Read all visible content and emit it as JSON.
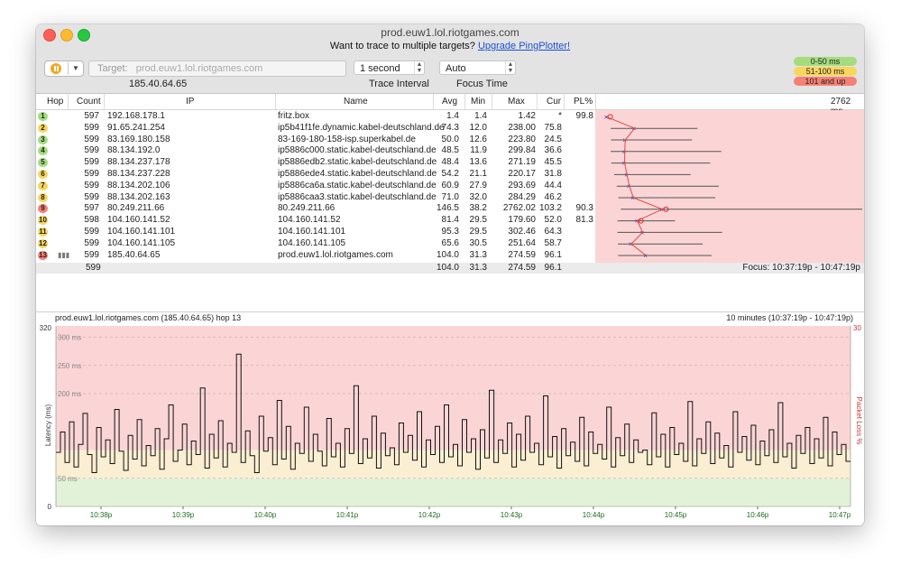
{
  "window": {
    "title": "prod.euw1.lol.riotgames.com"
  },
  "promo": {
    "text": "Want to trace to multiple targets?",
    "link": "Upgrade PingPlotter!"
  },
  "toolbar": {
    "target_label": "Target:",
    "target_value": "prod.euw1.lol.riotgames.com",
    "resolved_ip": "185.40.64.65",
    "interval_value": "1 second",
    "interval_label": "Trace Interval",
    "focus_value": "Auto",
    "focus_label": "Focus Time"
  },
  "latency_legend": [
    {
      "label": "0-50 ms",
      "color": "#a4dc7e"
    },
    {
      "label": "51-100 ms",
      "color": "#f7d65c"
    },
    {
      "label": "101 and up",
      "color": "#f77f74"
    }
  ],
  "table": {
    "columns": [
      "Hop",
      "Count",
      "IP",
      "Name",
      "Avg",
      "Min",
      "Max",
      "Cur",
      "PL%"
    ],
    "graph_max": "2762 ms",
    "rows": [
      {
        "hop": "1",
        "color": "#a4dc7e",
        "count": "597",
        "ip": "192.168.178.1",
        "name": "fritz.box",
        "avg": "1.4",
        "min": "1.4",
        "max": "1.42",
        "cur": "*",
        "pl": "99.8"
      },
      {
        "hop": "2",
        "color": "#f7d65c",
        "count": "599",
        "ip": "91.65.241.254",
        "name": "ip5b41f1fe.dynamic.kabel-deutschland.de",
        "avg": "74.3",
        "min": "12.0",
        "max": "238.00",
        "cur": "75.8",
        "pl": ""
      },
      {
        "hop": "3",
        "color": "#a4dc7e",
        "count": "599",
        "ip": "83.169.180.158",
        "name": "83-169-180-158-isp.superkabel.de",
        "avg": "50.0",
        "min": "12.6",
        "max": "223.80",
        "cur": "24.5",
        "pl": ""
      },
      {
        "hop": "4",
        "color": "#a4dc7e",
        "count": "599",
        "ip": "88.134.192.0",
        "name": "ip5886c000.static.kabel-deutschland.de",
        "avg": "48.5",
        "min": "11.9",
        "max": "299.84",
        "cur": "36.6",
        "pl": ""
      },
      {
        "hop": "5",
        "color": "#a4dc7e",
        "count": "599",
        "ip": "88.134.237.178",
        "name": "ip5886edb2.static.kabel-deutschland.de",
        "avg": "48.4",
        "min": "13.6",
        "max": "271.19",
        "cur": "45.5",
        "pl": ""
      },
      {
        "hop": "6",
        "color": "#f7d65c",
        "count": "599",
        "ip": "88.134.237.228",
        "name": "ip5886ede4.static.kabel-deutschland.de",
        "avg": "54.2",
        "min": "21.1",
        "max": "220.17",
        "cur": "31.8",
        "pl": ""
      },
      {
        "hop": "7",
        "color": "#f7d65c",
        "count": "599",
        "ip": "88.134.202.106",
        "name": "ip5886ca6a.static.kabel-deutschland.de",
        "avg": "60.9",
        "min": "27.9",
        "max": "293.69",
        "cur": "44.4",
        "pl": ""
      },
      {
        "hop": "8",
        "color": "#f7d65c",
        "count": "599",
        "ip": "88.134.202.163",
        "name": "ip5886caa3.static.kabel-deutschland.de",
        "avg": "71.0",
        "min": "32.0",
        "max": "284.29",
        "cur": "46.2",
        "pl": ""
      },
      {
        "hop": "9",
        "color": "#f77f74",
        "count": "597",
        "ip": "80.249.211.66",
        "name": "80.249.211.66",
        "avg": "146.5",
        "min": "38.2",
        "max": "2762.02",
        "cur": "103.2",
        "pl": "90.3"
      },
      {
        "hop": "10",
        "color": "#f7d65c",
        "count": "598",
        "ip": "104.160.141.52",
        "name": "104.160.141.52",
        "avg": "81.4",
        "min": "29.5",
        "max": "179.60",
        "cur": "52.0",
        "pl": "81.3"
      },
      {
        "hop": "11",
        "color": "#f7d65c",
        "count": "599",
        "ip": "104.160.141.101",
        "name": "104.160.141.101",
        "avg": "95.3",
        "min": "29.5",
        "max": "302.46",
        "cur": "64.3",
        "pl": ""
      },
      {
        "hop": "12",
        "color": "#f7d65c",
        "count": "599",
        "ip": "104.160.141.105",
        "name": "104.160.141.105",
        "avg": "65.6",
        "min": "30.5",
        "max": "251.64",
        "cur": "58.7",
        "pl": ""
      },
      {
        "hop": "13",
        "color": "#f77f74",
        "count": "599",
        "ip": "185.40.64.65",
        "name": "prod.euw1.lol.riotgames.com",
        "avg": "104.0",
        "min": "31.3",
        "max": "274.59",
        "cur": "96.1",
        "pl": ""
      }
    ],
    "summary": {
      "count": "599",
      "avg": "104.0",
      "min": "31.3",
      "max": "274.59",
      "cur": "96.1",
      "focus": "Focus: 10:37:19p - 10:47:19p"
    }
  },
  "timeline": {
    "title": "prod.euw1.lol.riotgames.com (185.40.64.65) hop 13",
    "range": "10 minutes (10:37:19p - 10:47:19p)",
    "y_axis_label": "Latency (ms)",
    "y2_axis_label": "Packet Loss %",
    "y_top": "320",
    "y_bottom": "0",
    "y2_top": "30",
    "gridlines": [
      "300 ms",
      "250 ms",
      "200 ms",
      "50 ms"
    ]
  },
  "chart_data": {
    "type": "line",
    "title": "prod.euw1.lol.riotgames.com (185.40.64.65) hop 13",
    "xlabel": "",
    "ylabel": "Latency (ms)",
    "ylim": [
      0,
      320
    ],
    "x_ticks": [
      "10:38p",
      "10:39p",
      "10:40p",
      "10:41p",
      "10:42p",
      "10:43p",
      "10:44p",
      "10:45p",
      "10:46p",
      "10:47p"
    ],
    "bands": [
      {
        "range": [
          0,
          50
        ],
        "color": "#e2f2d8"
      },
      {
        "range": [
          50,
          100
        ],
        "color": "#fbefd3"
      },
      {
        "range": [
          100,
          320
        ],
        "color": "#fbd5d5"
      }
    ],
    "grid": true,
    "values": [
      96,
      132,
      78,
      150,
      70,
      110,
      165,
      92,
      60,
      140,
      88,
      118,
      76,
      172,
      98,
      64,
      126,
      84,
      154,
      72,
      108,
      90,
      138,
      66,
      120,
      180,
      80,
      100,
      146,
      74,
      116,
      92,
      210,
      68,
      128,
      86,
      152,
      70,
      112,
      96,
      270,
      78,
      134,
      90,
      60,
      160,
      98,
      122,
      74,
      188,
      84,
      142,
      66,
      112,
      94,
      176,
      80,
      128,
      98,
      72,
      156,
      88,
      112,
      70,
      138,
      94,
      214,
      76,
      120,
      86,
      160,
      68,
      130,
      90,
      104,
      74,
      148,
      96,
      126,
      82,
      168,
      70,
      118,
      92,
      142,
      78,
      180,
      88,
      110,
      72,
      154,
      96,
      120,
      66,
      136,
      86,
      206,
      78,
      118,
      94,
      148,
      70,
      128,
      82,
      160,
      96,
      112,
      74,
      196,
      88,
      124,
      68,
      138,
      90,
      114,
      80,
      158,
      72,
      132,
      94,
      110,
      84,
      176,
      70,
      122,
      90,
      146,
      78,
      118,
      96,
      100,
      74,
      166,
      88,
      128,
      70,
      140,
      92,
      112,
      80,
      186,
      72,
      120,
      94,
      150,
      76,
      130,
      86,
      108,
      70,
      168,
      96,
      124,
      82,
      144,
      74,
      116,
      90,
      136,
      78,
      184,
      88,
      112,
      68,
      126,
      94,
      140,
      76,
      120,
      86,
      158,
      72,
      132,
      92,
      110,
      80
    ]
  }
}
